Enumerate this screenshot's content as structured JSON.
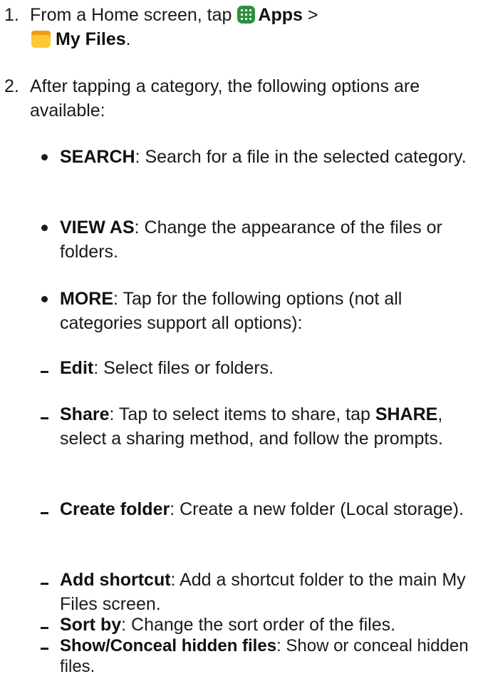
{
  "steps": [
    {
      "number": "1.",
      "intro": "From a Home screen, tap",
      "apps_label": "Apps",
      "separator": ">",
      "files_label": "My Files",
      "end": "."
    },
    {
      "number": "2.",
      "text": "After tapping a category, the following options are available:"
    }
  ],
  "options": [
    {
      "label": "SEARCH",
      "desc": ": Search for a file in the selected category."
    },
    {
      "label": "VIEW AS",
      "desc": ": Change the appearance of the files or folders."
    },
    {
      "label": "MORE",
      "desc": ": Tap for the following options (not all categories support all options):"
    }
  ],
  "more_options": [
    {
      "label": "Edit",
      "desc": ": Select files or folders."
    },
    {
      "label": "Share",
      "desc": ": Tap to select items to share, tap ",
      "label2": "SHARE",
      "desc2": ", select a sharing method, and follow the prompts."
    },
    {
      "label": "Create folder",
      "desc": ": Create a new folder (Local storage)."
    },
    {
      "label": "Add shortcut",
      "desc": ": Add a shortcut folder to the main My Files screen."
    },
    {
      "label": "Sort by",
      "desc": ": Change the sort order of the files."
    },
    {
      "label": "Show/Conceal hidden files",
      "desc": ": Show or conceal hidden files."
    }
  ],
  "icons": {
    "apps": "apps-grid-icon",
    "files": "my-files-folder-icon",
    "apps_color": "#2e8f3e",
    "files_color": "#f6b71d"
  }
}
